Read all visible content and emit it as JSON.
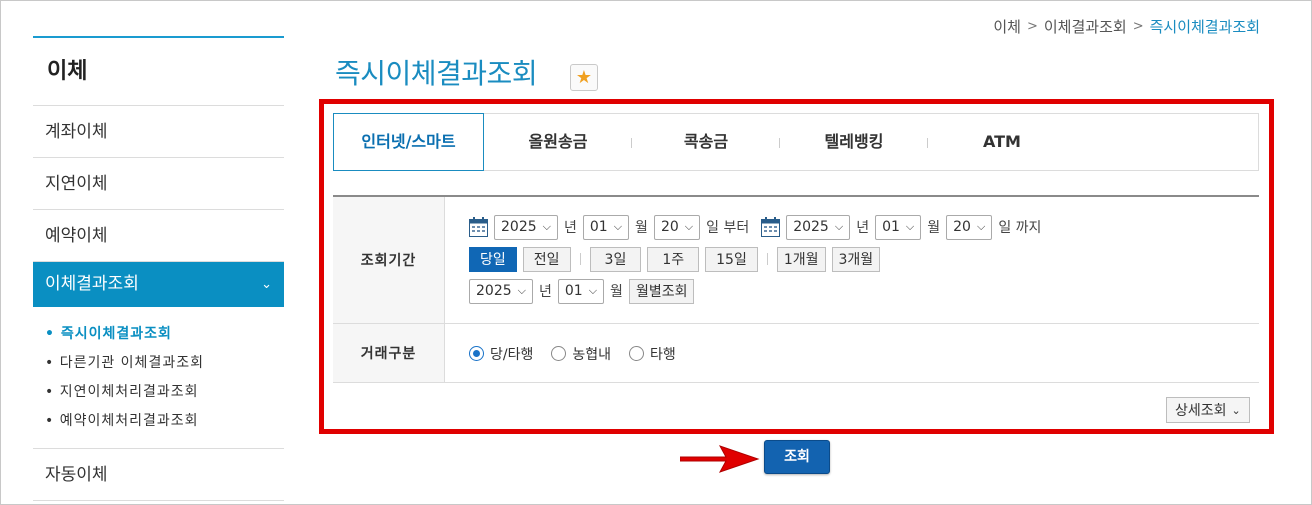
{
  "breadcrumb": {
    "items": [
      "이체",
      "이체결과조회",
      "즉시이체결과조회"
    ],
    "separator": ">"
  },
  "sidebar": {
    "title": "이체",
    "items": [
      {
        "label": "계좌이체"
      },
      {
        "label": "지연이체"
      },
      {
        "label": "예약이체"
      },
      {
        "label": "이체결과조회",
        "active": true
      }
    ],
    "chevron": "⌄",
    "sub_items": [
      {
        "label": "• 즉시이체결과조회",
        "active": true
      },
      {
        "label": "• 다른기관 이체결과조회"
      },
      {
        "label": "• 지연이체처리결과조회"
      },
      {
        "label": "• 예약이체처리결과조회"
      }
    ],
    "after_items": [
      {
        "label": "자동이체"
      }
    ]
  },
  "page": {
    "title": "즉시이체결과조회",
    "favorite_icon": "star-icon"
  },
  "tabs": [
    {
      "label": "인터넷/스마트",
      "active": true
    },
    {
      "label": "올원송금"
    },
    {
      "label": "콕송금"
    },
    {
      "label": "텔레뱅킹"
    },
    {
      "label": "ATM"
    }
  ],
  "form": {
    "period": {
      "label": "조회기간",
      "from": {
        "year": "2025",
        "year_unit": "년",
        "month": "01",
        "month_unit": "월",
        "day": "20",
        "day_unit": "일 부터"
      },
      "to": {
        "year": "2025",
        "year_unit": "년",
        "month": "01",
        "month_unit": "월",
        "day": "20",
        "day_unit": "일 까지"
      },
      "quick_buttons": [
        "당일",
        "전일",
        "3일",
        "1주",
        "15일",
        "1개월",
        "3개월"
      ],
      "quick_selected": "당일",
      "monthly": {
        "year": "2025",
        "year_unit": "년",
        "month": "01",
        "month_unit": "월",
        "button": "월별조회"
      }
    },
    "type": {
      "label": "거래구분",
      "options": [
        "당/타행",
        "농협내",
        "타행"
      ],
      "selected": "당/타행"
    },
    "detail_button": "상세조회",
    "detail_chevron": "⌄"
  },
  "search_button": "조회",
  "colors": {
    "accent": "#1a8cc0",
    "highlight": "#e00000",
    "primary_button": "#1363b0"
  }
}
